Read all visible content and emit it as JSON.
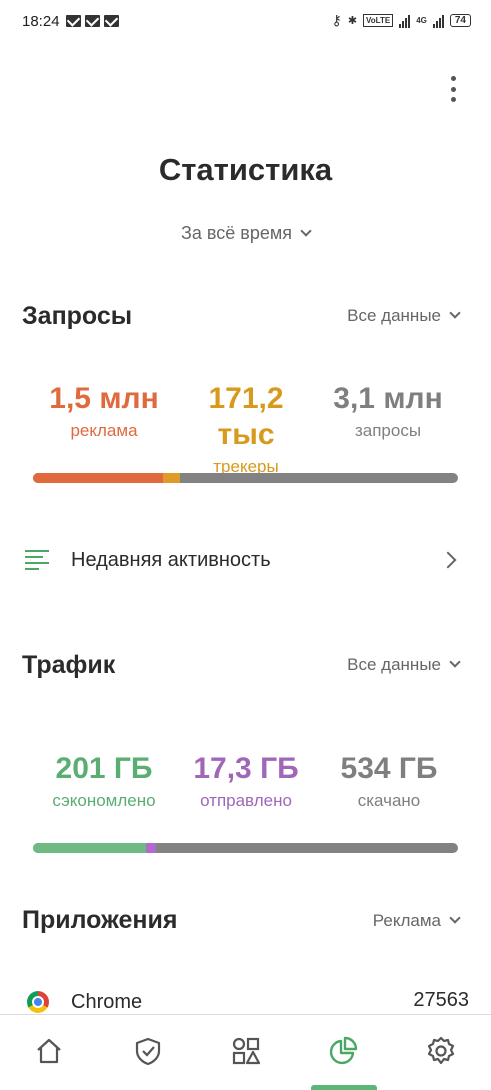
{
  "status_bar": {
    "time": "18:24",
    "volte": "VoLTE",
    "network": "4G",
    "battery": "74"
  },
  "header": {
    "title": "Статистика",
    "period": "За всё время"
  },
  "requests": {
    "title": "Запросы",
    "filter": "Все данные",
    "stats": [
      {
        "value": "1,5 млн",
        "label": "реклама",
        "color": "#e06a3d"
      },
      {
        "value": "171,2 тыс",
        "label": "трекеры",
        "color": "#d89a1c"
      },
      {
        "value": "3,1 млн",
        "label": "запросы",
        "color": "#7f7f7f"
      }
    ],
    "bar": [
      {
        "name": "ads",
        "fraction": 0.305,
        "color": "#e06a3d"
      },
      {
        "name": "trackers",
        "fraction": 0.04,
        "color": "#e09a2a"
      }
    ]
  },
  "recent_activity": {
    "label": "Недавняя активность"
  },
  "traffic": {
    "title": "Трафик",
    "filter": "Все данные",
    "stats": [
      {
        "value": "201 ГБ",
        "label": "сэкономлено",
        "color": "#5aae72"
      },
      {
        "value": "17,3 ГБ",
        "label": "отправлено",
        "color": "#a067b8"
      },
      {
        "value": "534 ГБ",
        "label": "скачано",
        "color": "#7f7f7f"
      }
    ],
    "bar": [
      {
        "name": "saved",
        "fraction": 0.265,
        "color": "#6fba82"
      },
      {
        "name": "sent",
        "fraction": 0.025,
        "color": "#b06ad0"
      }
    ]
  },
  "apps": {
    "title": "Приложения",
    "filter": "Реклама",
    "items": [
      {
        "name": "Chrome",
        "count": "27563"
      }
    ]
  },
  "bottom_nav": {
    "items": [
      "home",
      "protection",
      "apps",
      "statistics",
      "settings"
    ],
    "active": "statistics",
    "accent": "#5cb776"
  }
}
